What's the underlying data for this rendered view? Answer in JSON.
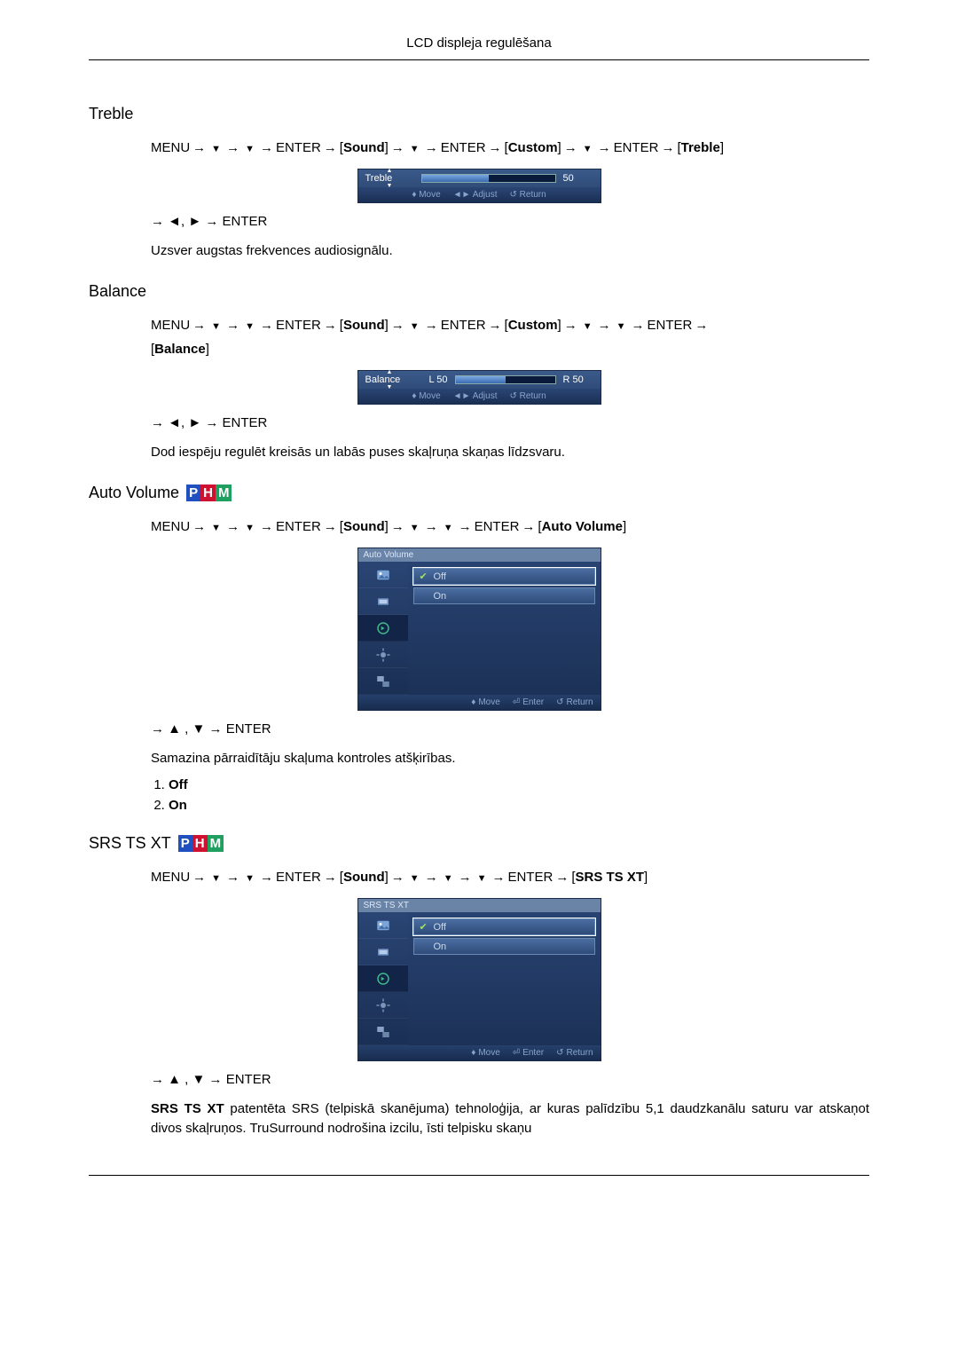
{
  "header": {
    "title": "LCD displeja regulēšana"
  },
  "nav": {
    "menu": "MENU",
    "enter": "ENTER",
    "sound": "Sound",
    "custom": "Custom"
  },
  "osd_common": {
    "move": "Move",
    "adjust": "Adjust",
    "enter": "Enter",
    "return": "Return",
    "off": "Off",
    "on": "On"
  },
  "treble": {
    "heading": "Treble",
    "final": "Treble",
    "adjust_line": "→ ◄, ► → ENTER",
    "desc": "Uzsver augstas frekvences audiosignālu.",
    "osd": {
      "label": "Treble",
      "value": "50",
      "fill_pct": 50
    }
  },
  "balance": {
    "heading": "Balance",
    "final": "Balance",
    "adjust_line": "→ ◄, ► → ENTER",
    "desc": "Dod iespēju regulēt kreisās un labās puses skaļruņa skaņas līdzsvaru.",
    "osd": {
      "label": "Balance",
      "l": "L 50",
      "r": "R 50",
      "fill_pct": 50
    }
  },
  "autovol": {
    "heading": "Auto Volume",
    "final": "Auto Volume",
    "adjust_line": "→ ▲ , ▼ → ENTER",
    "desc": "Samazina pārraidītāju skaļuma kontroles atšķirības.",
    "osd": {
      "title": "Auto Volume"
    },
    "list": {
      "i1": "Off",
      "i2": "On"
    }
  },
  "srs": {
    "heading": "SRS TS XT",
    "final": "SRS TS XT",
    "adjust_line": "→ ▲ , ▼ → ENTER",
    "desc_prefix": "SRS TS XT",
    "desc_rest": " patentēta SRS (telpiskā skanējuma) tehnoloģija, ar kuras palīdzību 5,1 daudzkanālu saturu var atskaņot divos skaļruņos. TruSurround nodrošina izcilu, īsti telpisku skaņu",
    "osd": {
      "title": "SRS TS XT"
    }
  }
}
